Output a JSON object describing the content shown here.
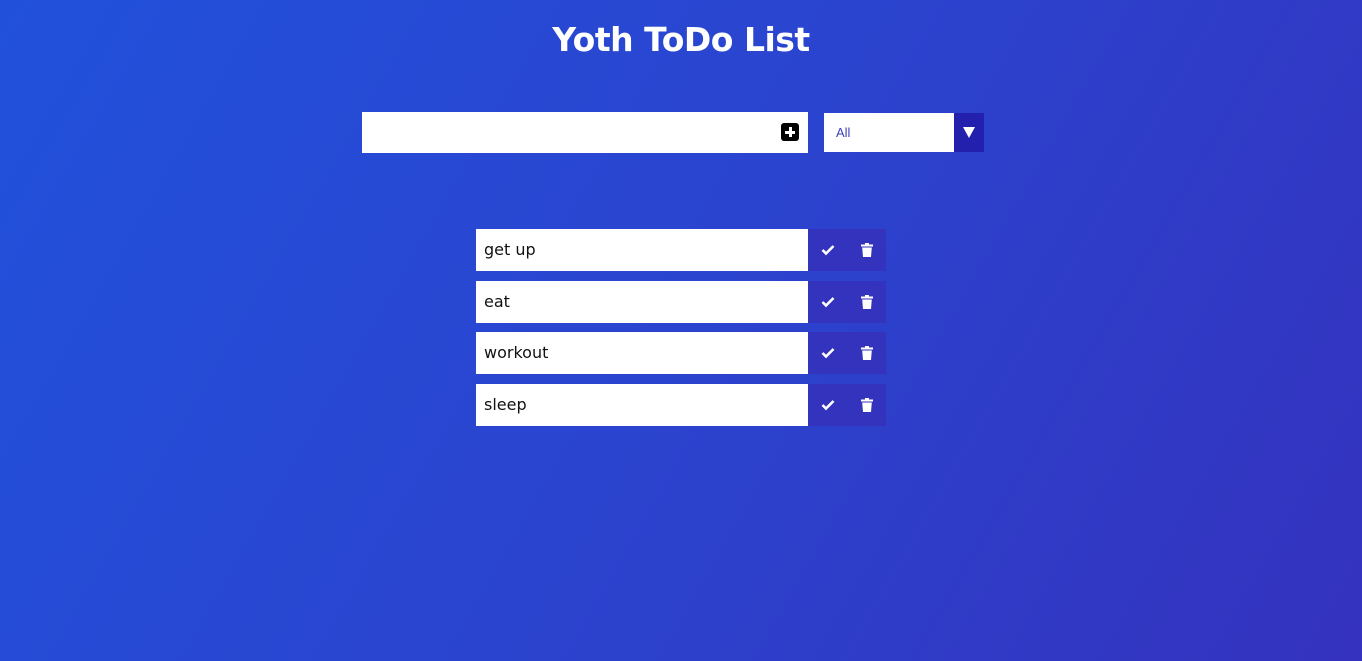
{
  "header": {
    "title": "Yoth ToDo List"
  },
  "form": {
    "input_value": "",
    "input_placeholder": "",
    "add_icon": "plus-square-icon"
  },
  "filter": {
    "selected": "All",
    "icon": "caret-down-icon"
  },
  "todos": [
    {
      "text": "get up"
    },
    {
      "text": "eat"
    },
    {
      "text": "workout"
    },
    {
      "text": "sleep"
    }
  ],
  "colors": {
    "background_start": "#2151db",
    "background_end": "#3432be",
    "action_button": "#3433bd",
    "select_arrow": "#2320ad"
  }
}
